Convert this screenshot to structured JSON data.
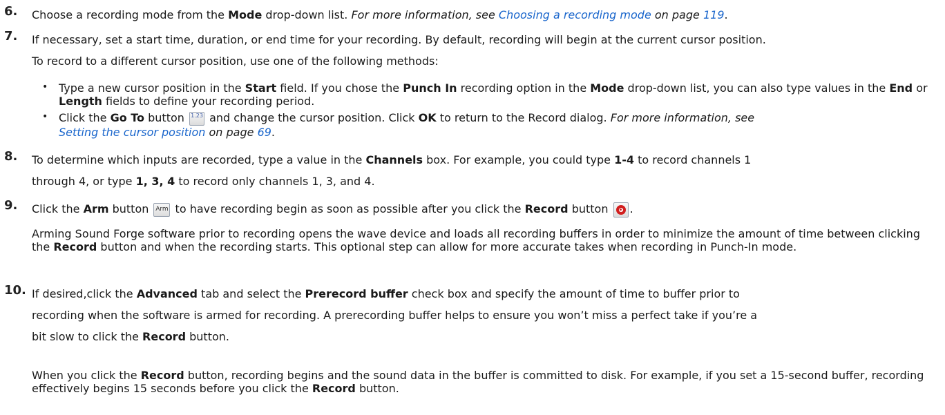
{
  "s6": {
    "num": "6.",
    "t1": "Choose a recording mode from the ",
    "b1": "Mode",
    "t2": " drop-down list. ",
    "i1": "For more information, see ",
    "l1": "Choosing a recording mode",
    "i2": " on page ",
    "l2": "119",
    "t3": "."
  },
  "s7": {
    "num": "7.",
    "line1": "If necessary, set a start time, duration, or end time for your recording. By default, recording will begin at the current cursor position.",
    "line2": "To record to a different cursor position, use one of the following methods:"
  },
  "b1": {
    "t1": "Type a new cursor position in the ",
    "b1": "Start",
    "t2": " field. If you chose the ",
    "b2": "Punch In",
    "t3": " recording option in the ",
    "b3": "Mode",
    "t4": " drop-down list, you can also type values in the ",
    "b4": "End",
    "t5": " or ",
    "b5": "Length",
    "t6": " fields to define your recording period."
  },
  "b2": {
    "t1": "Click the ",
    "b1": "Go To",
    "t2": " button ",
    "icon": "1.23",
    "t3": " and change the cursor position. Click ",
    "b2": "OK",
    "t4": " to return to the Record dialog. ",
    "i1": "For more information, see",
    "l1": "Setting the cursor position",
    "i2": " on page ",
    "l2": "69",
    "t5": "."
  },
  "s8": {
    "num": "8.",
    "t1": "To determine which inputs are recorded, type a value in the ",
    "b1": "Channels",
    "t2": " box. For example, you could type ",
    "b2": "1-4",
    "t3": " to record channels 1",
    "t4": "through 4, or type ",
    "b3": "1, 3, 4",
    "t5": " to record only channels 1, 3, and 4."
  },
  "s9": {
    "num": "9.",
    "t1": "Click the ",
    "b1": "Arm",
    "t2": " button ",
    "icon": "Arm",
    "t3": " to have recording begin as soon as possible after you click the ",
    "b2": "Record",
    "t4": " button ",
    "t5": "."
  },
  "p9": {
    "t1": "Arming Sound Forge software prior to recording opens the wave device and loads all recording buffers in order to minimize the amount of time between clicking the ",
    "b1": "Record",
    "t2": " button and when the recording starts. This optional step can allow for more accurate takes when recording in Punch-In mode."
  },
  "s10": {
    "num": "10.",
    "t1": "If desired,click the ",
    "b1": "Advanced",
    "t2": " tab and select the ",
    "b2": "Prerecord buffer",
    "t3": " check box and specify the amount of time to buffer prior to",
    "t4": "recording when the software is armed for recording. A prerecording buffer helps to ensure you won’t miss a perfect take if you’re a",
    "t5": "bit slow to click the ",
    "b3": "Record",
    "t6": " button."
  },
  "p10": {
    "t1": "When you click the ",
    "b1": "Record",
    "t2": " button, recording begins and the sound data in the buffer is committed to disk. For example, if you set a 15-second buffer, recording effectively begins 15 seconds before you click the ",
    "b2": "Record",
    "t3": " button."
  }
}
